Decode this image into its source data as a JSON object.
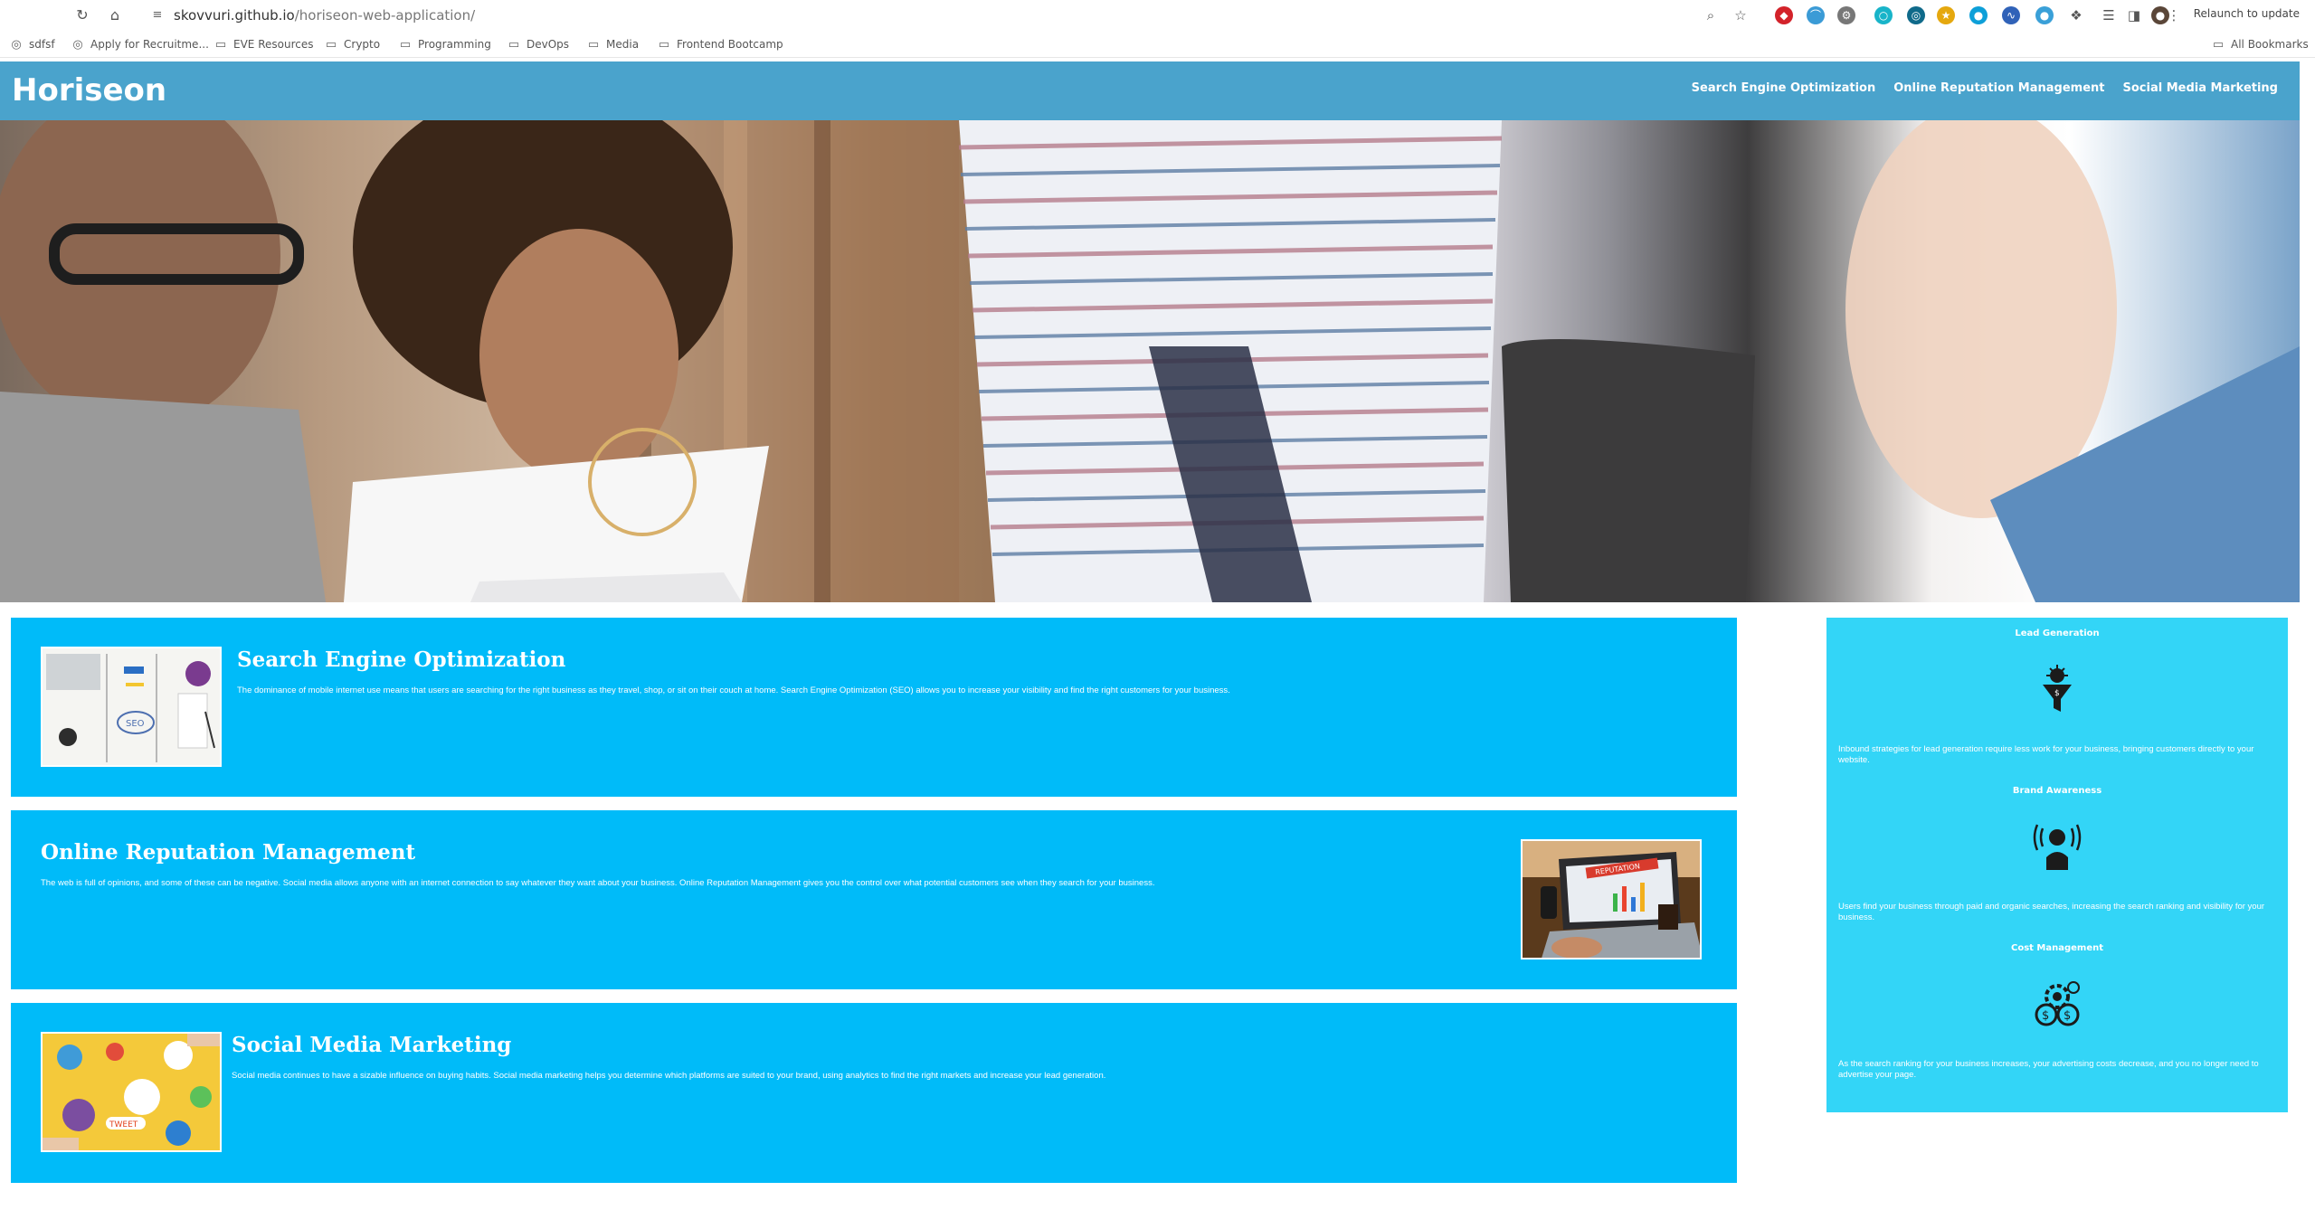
{
  "browser": {
    "url_host": "skovvuri.github.io",
    "url_path": "/horiseon-web-application/",
    "relaunch_label": "Relaunch to update",
    "bookmarks": [
      "sdfsf",
      "Apply for Recruitme...",
      "EVE Resources",
      "Crypto",
      "Programming",
      "DevOps",
      "Media",
      "Frontend Bootcamp"
    ],
    "all_bookmarks": "All Bookmarks"
  },
  "header": {
    "logo": "Horiseon",
    "nav": [
      "Search Engine Optimization",
      "Online Reputation Management",
      "Social Media Marketing"
    ]
  },
  "cards": [
    {
      "title": "Search Engine Optimization",
      "text": "The dominance of mobile internet use means that users are searching for the right business as they travel, shop, or sit on their couch at home. Search Engine Optimization (SEO) allows you to increase your visibility and find the right customers for your business."
    },
    {
      "title": "Online Reputation Management",
      "text": "The web is full of opinions, and some of these can be negative. Social media allows anyone with an internet connection to say whatever they want about your business. Online Reputation Management gives you the control over what potential customers see when they search for your business.",
      "image_caption": "REPUTATION"
    },
    {
      "title": "Social Media Marketing",
      "text": "Social media continues to have a sizable influence on buying habits. Social media marketing helps you determine which platforms are suited to your brand, using analytics to find the right markets and increase your lead generation.",
      "image_caption": "TWEET"
    }
  ],
  "benefits": [
    {
      "title": "Lead Generation",
      "icon": "lead-generation-icon",
      "text": "Inbound strategies for lead generation require less work for your business, bringing customers directly to your website."
    },
    {
      "title": "Brand Awareness",
      "icon": "brand-awareness-icon",
      "text": "Users find your business through paid and organic searches, increasing the search ranking and visibility for your business."
    },
    {
      "title": "Cost Management",
      "icon": "cost-management-icon",
      "text": "As the search ranking for your business increases, your advertising costs decrease, and you no longer need to advertise your page."
    }
  ],
  "colors": {
    "header": "#4aa3cc",
    "card": "#00bbf9",
    "benefits": "#33d5f7"
  }
}
